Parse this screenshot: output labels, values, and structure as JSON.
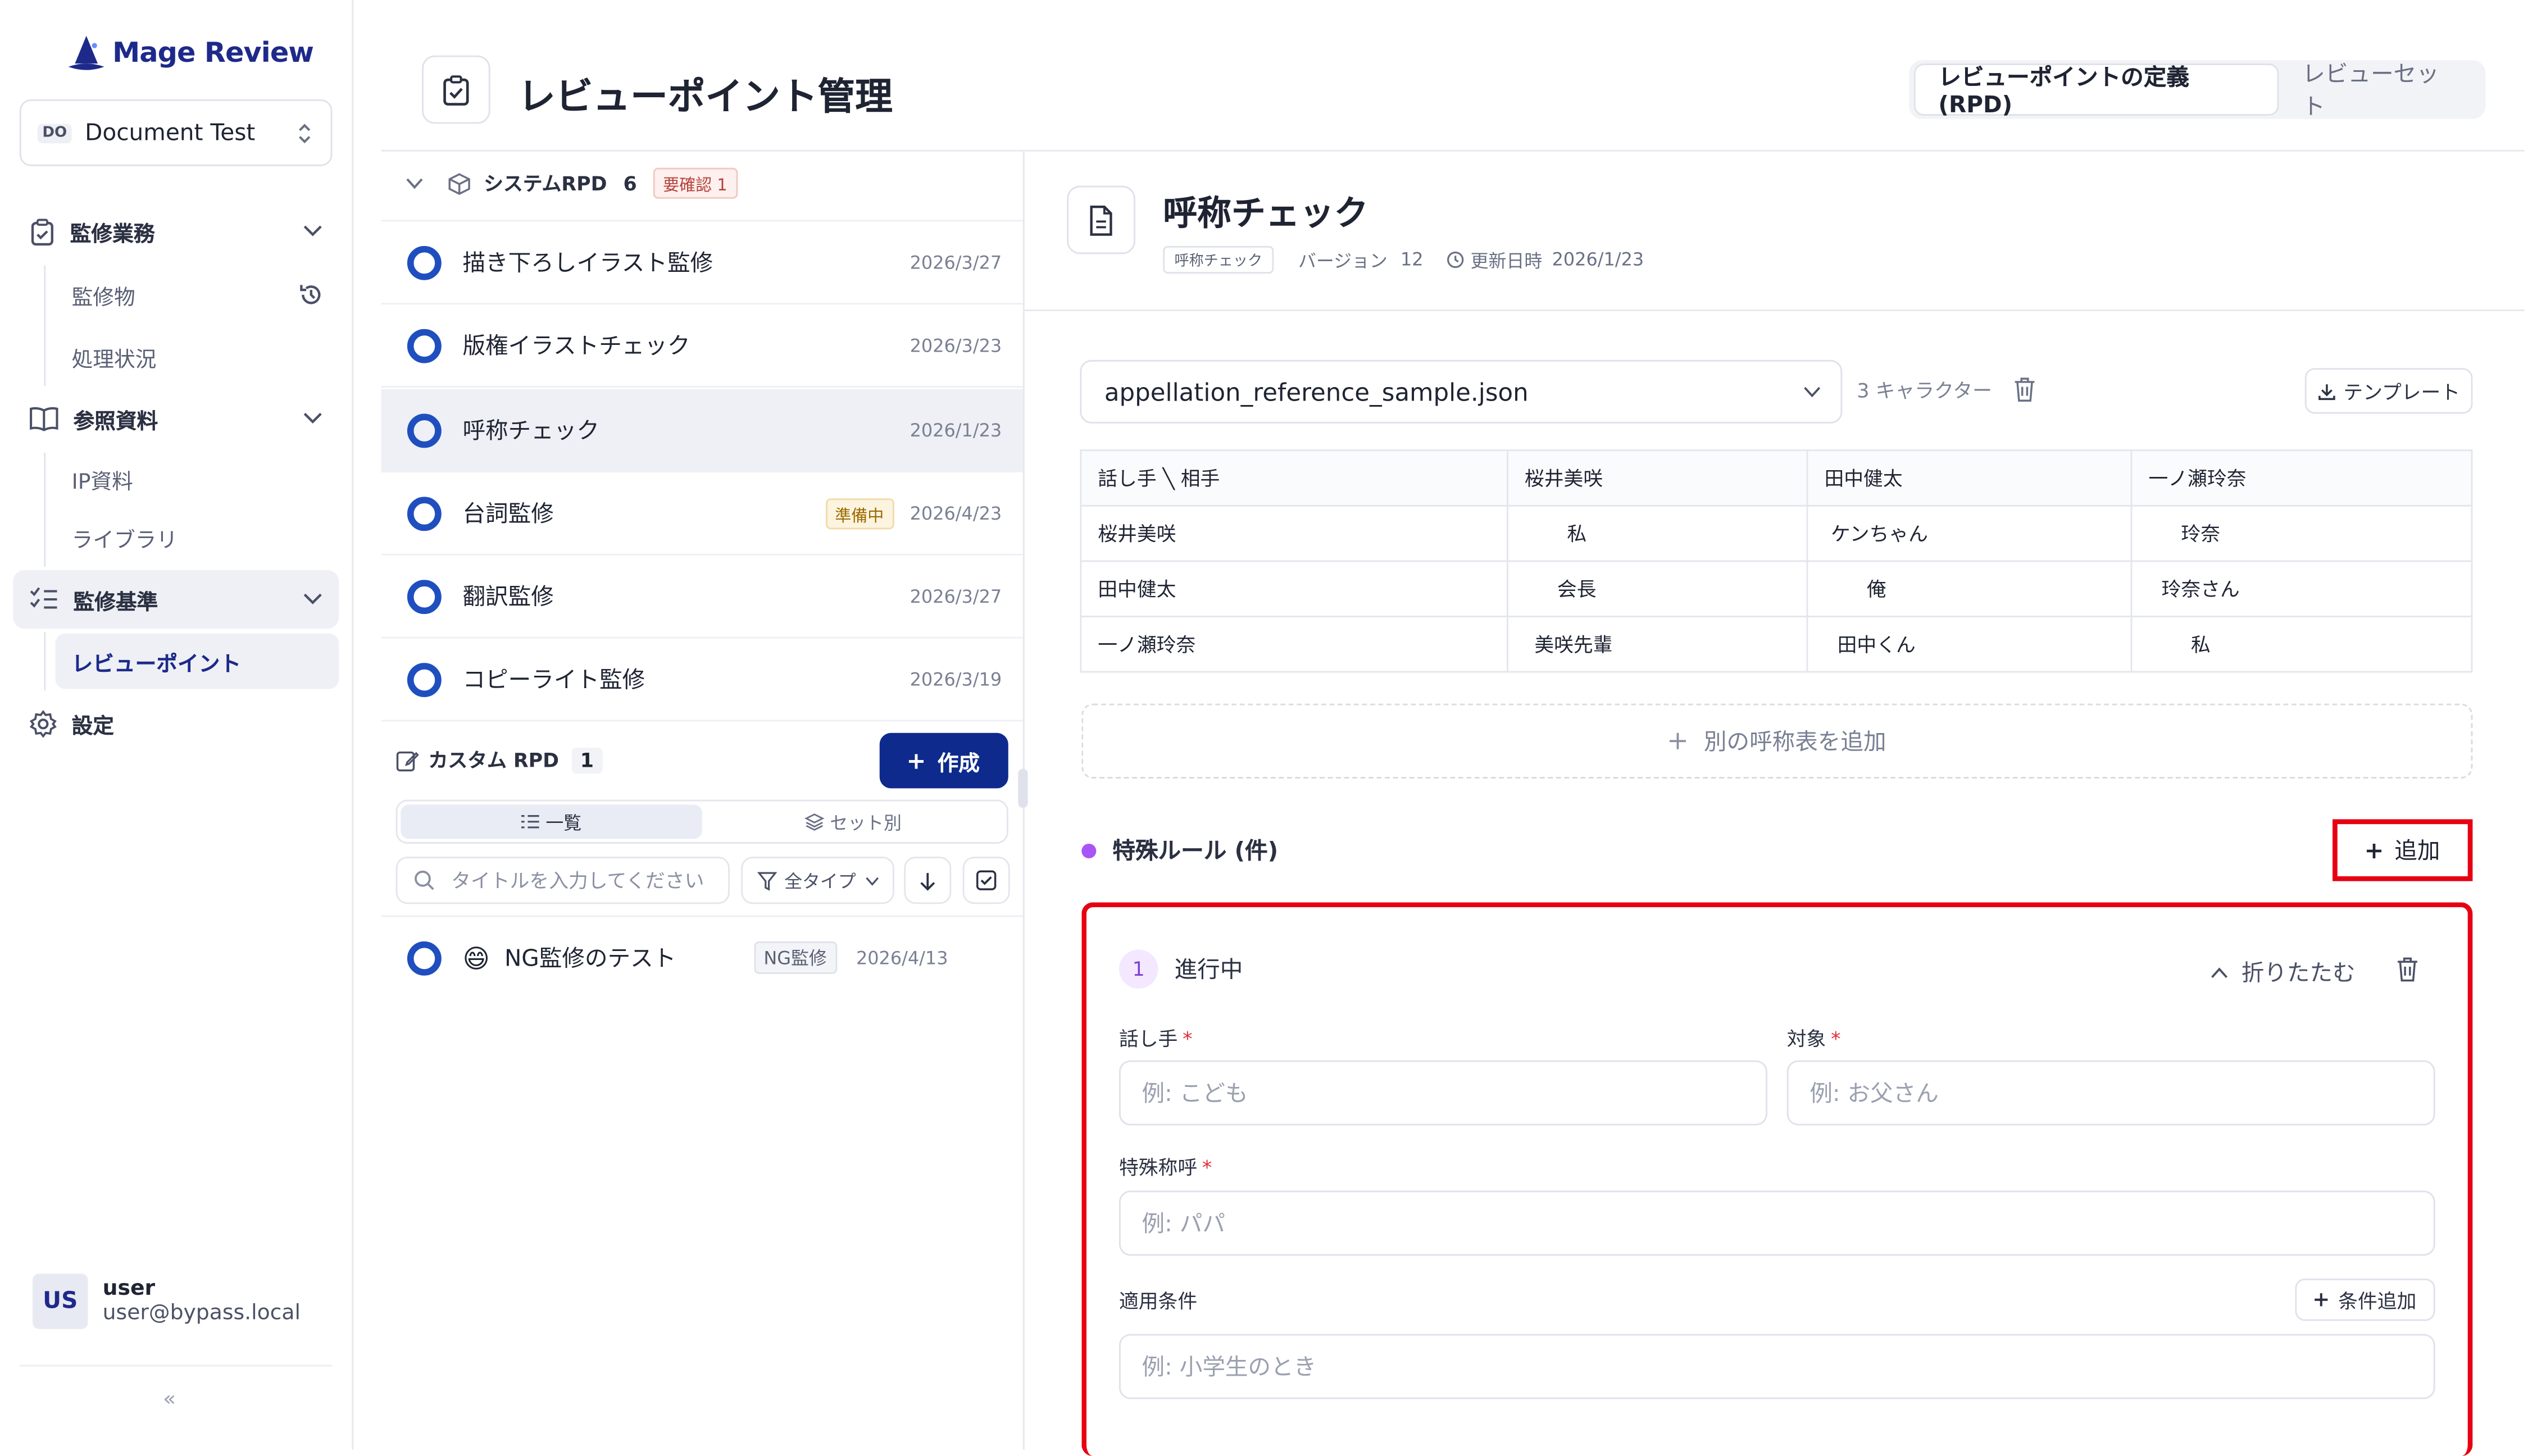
{
  "app": {
    "name": "Mage Review"
  },
  "workspace": {
    "badge": "DO",
    "name": "Document Test"
  },
  "sidebar": {
    "sections": [
      {
        "label": "監修業務",
        "children": [
          "監修物",
          "処理状況"
        ]
      },
      {
        "label": "参照資料",
        "children": [
          "IP資料",
          "ライブラリ"
        ]
      },
      {
        "label": "監修基準",
        "children": [
          "レビューポイント"
        ]
      },
      {
        "label": "設定"
      }
    ]
  },
  "user": {
    "initials": "US",
    "name": "user",
    "email": "user@bypass.local",
    "collapse": "«"
  },
  "header": {
    "title": "レビューポイント管理",
    "tabs": [
      {
        "label": "レビューポイントの定義(RPD)"
      },
      {
        "label": "レビューセット"
      }
    ]
  },
  "system_group": {
    "title": "システムRPD",
    "count": "6",
    "badge": "要確認 1"
  },
  "items": [
    {
      "title": "描き下ろしイラスト監修",
      "date": "2026/3/27"
    },
    {
      "title": "版権イラストチェック",
      "date": "2026/3/23"
    },
    {
      "title": "呼称チェック",
      "date": "2026/1/23"
    },
    {
      "title": "台詞監修",
      "date": "2026/4/23",
      "badge": "準備中"
    },
    {
      "title": "翻訳監修",
      "date": "2026/3/27"
    },
    {
      "title": "コピーライト監修",
      "date": "2026/3/19"
    }
  ],
  "custom_group": {
    "title": "カスタム RPD",
    "count": "1",
    "create_label": "作成"
  },
  "view_tabs": [
    {
      "label": "一覧"
    },
    {
      "label": "セット別"
    }
  ],
  "filter": {
    "search_placeholder": "タイトルを入力してください",
    "type_label": "全タイプ"
  },
  "custom_items": [
    {
      "emoji": "😄",
      "title": "NG監修のテスト",
      "badge": "NG監修",
      "date": "2026/4/13"
    }
  ],
  "detail": {
    "title": "呼称チェック",
    "tag": "呼称チェック",
    "version_label": "バージョン",
    "version": "12",
    "updated_label": "更新日時",
    "updated": "2026/1/23",
    "file": "appellation_reference_sample.json",
    "char_count": "3 キャラクター",
    "template_label": "テンプレート",
    "table": {
      "header": [
        "話し手 ╲ 相手",
        "桜井美咲",
        "田中健太",
        "一ノ瀬玲奈"
      ],
      "rows": [
        [
          "桜井美咲",
          "私",
          "ケンちゃん",
          "玲奈"
        ],
        [
          "田中健太",
          "会長",
          "俺",
          "玲奈さん"
        ],
        [
          "一ノ瀬玲奈",
          "美咲先輩",
          "田中くん",
          "私"
        ]
      ]
    },
    "add_table_label": "別の呼称表を追加",
    "rules_title": "特殊ルール (件)",
    "add_label": "追加",
    "rule": {
      "index": "1",
      "status": "進行中",
      "collapse_label": "折りたたむ",
      "speaker_label": "話し手",
      "speaker_placeholder": "例: こども",
      "target_label": "対象",
      "target_placeholder": "例: お父さん",
      "special_label": "特殊称呼",
      "special_placeholder": "例: パパ",
      "condition_label": "適用条件",
      "condition_add_label": "条件追加",
      "condition_placeholder": "例: 小学生のとき",
      "required_mark": "*"
    }
  },
  "colors": {
    "brand": "#1d2a8a",
    "primary": "#0d2a8c",
    "ring": "#1f4fbf",
    "highlight": "#e60012",
    "rule_dot": "#a855f7"
  }
}
